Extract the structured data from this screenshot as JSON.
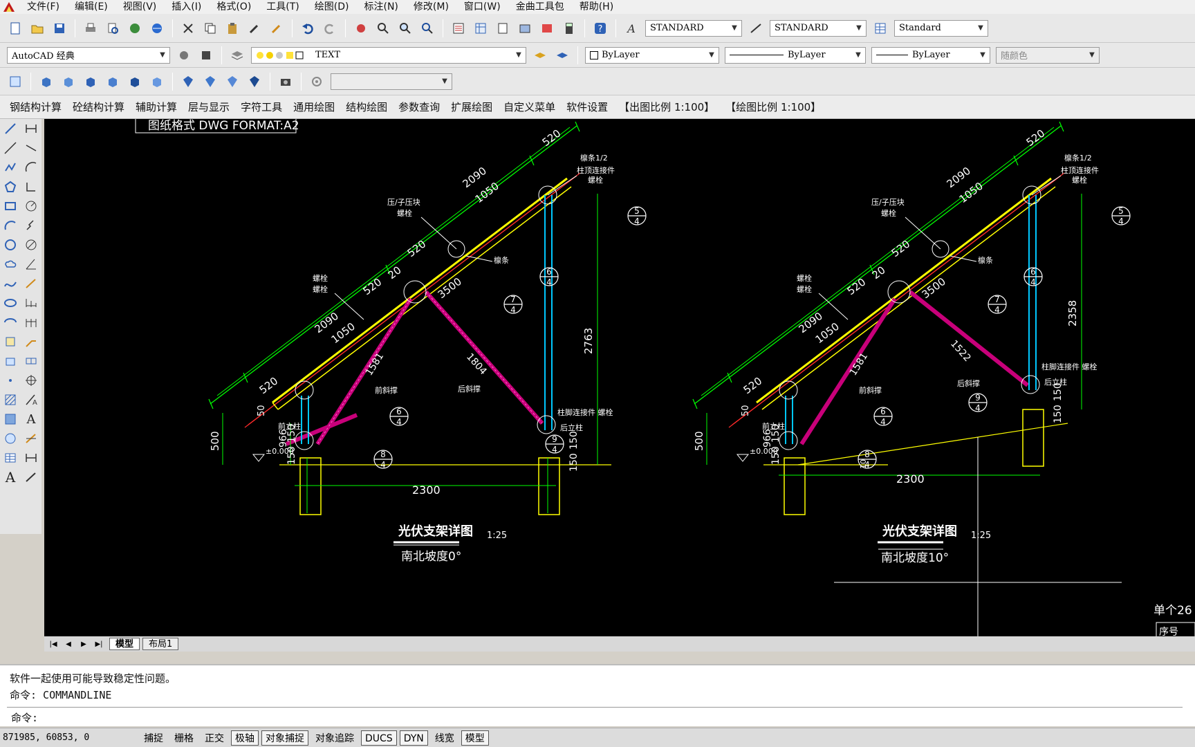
{
  "menubar": {
    "items": [
      "文件(F)",
      "编辑(E)",
      "视图(V)",
      "插入(I)",
      "格式(O)",
      "工具(T)",
      "绘图(D)",
      "标注(N)",
      "修改(M)",
      "窗口(W)",
      "金曲工具包",
      "帮助(H)"
    ]
  },
  "toolbar": {
    "text_style": "STANDARD",
    "dim_style": "STANDARD",
    "table_style": "Standard",
    "workspace": "AutoCAD 经典",
    "layer": "TEXT",
    "color": "ByLayer",
    "linetype": "ByLayer",
    "lineweight": "ByLayer",
    "plotstyle": "随颜色"
  },
  "cnmenu": {
    "items": [
      "钢结构计算",
      "砼结构计算",
      "辅助计算",
      "层与显示",
      "字符工具",
      "通用绘图",
      "结构绘图",
      "参数查询",
      "扩展绘图",
      "自定义菜单",
      "软件设置",
      "【出图比例 1:100】",
      "【绘图比例 1:100】"
    ]
  },
  "drawing": {
    "header_text": "图纸格式 DWG FORMAT:A2",
    "left": {
      "title": "光伏支架详图",
      "scale": "1:25",
      "subtitle": "南北坡度0°",
      "dims": {
        "top_520": "520",
        "top_2090": "2090",
        "top_1050": "1050",
        "mid_520a": "520",
        "mid_20": "20",
        "mid_520b": "520",
        "mid_3500": "3500",
        "low_2090": "2090",
        "low_1050": "1050",
        "low_520": "520",
        "d1581": "1581",
        "d1804": "1804",
        "d2763": "2763",
        "d2300": "2300",
        "d500": "500",
        "d966": "966",
        "d150a": "150",
        "d150b": "150",
        "d150c": "150",
        "d150d": "150",
        "d50": "50",
        "elev": "±0.000"
      },
      "labels": {
        "l1": "檩条1/2",
        "l2": "柱顶连接件",
        "l2b": "螺栓",
        "l3": "压/子压块",
        "l3b": "螺栓",
        "l4": "檩条",
        "l5": "螺栓",
        "l5b": "螺栓",
        "l6": "前斜撑",
        "l7": "后斜撑",
        "l8": "柱脚连接件 螺栓",
        "l9": "后立柱",
        "l10": "前立柱"
      },
      "bubbles": [
        "5",
        "6",
        "7",
        "6",
        "8",
        "9"
      ],
      "bubble_sub": "4"
    },
    "right": {
      "title": "光伏支架详图",
      "scale": "1:25",
      "subtitle": "南北坡度10°",
      "dims": {
        "top_520": "520",
        "top_2090": "2090",
        "top_1050": "1050",
        "mid_520a": "520",
        "mid_20": "20",
        "mid_520b": "520",
        "mid_3500": "3500",
        "low_2090": "2090",
        "low_1050": "1050",
        "low_520": "520",
        "d1581": "1581",
        "d1522": "1522",
        "d2358": "2358",
        "d2300": "2300",
        "d500": "500",
        "d966": "966",
        "d150a": "150",
        "d150b": "150",
        "d150c": "150",
        "d150d": "150",
        "d50": "50",
        "elev": "±0.000",
        "d10": "10"
      },
      "labels": {
        "l1": "檩条1/2",
        "l2": "柱顶连接件",
        "l2b": "螺栓",
        "l3": "压/子压块",
        "l3b": "螺栓",
        "l4": "檩条",
        "l5": "螺栓",
        "l5b": "螺栓",
        "l6": "前斜撑",
        "l7": "后斜撑",
        "l8": "柱脚连接件 螺栓",
        "l9": "后立柱",
        "l10": "前立柱"
      },
      "bubbles": [
        "5",
        "6",
        "7",
        "6",
        "8",
        "9"
      ],
      "bubble_sub": "4"
    },
    "corner_text": "单个26",
    "corner_text2": "序号"
  },
  "tabs": {
    "model": "模型",
    "layout1": "布局1"
  },
  "command": {
    "line1": "软件一起使用可能导致稳定性问题。",
    "line2": "命令: COMMANDLINE",
    "prompt": "命令:"
  },
  "status": {
    "coords": "871985, 60853, 0",
    "buttons": [
      "捕捉",
      "栅格",
      "正交",
      "极轴",
      "对象捕捉",
      "对象追踪",
      "DUCS",
      "DYN",
      "线宽",
      "模型"
    ]
  },
  "colors": {
    "canvas_bg": "#000000",
    "dim_green": "#00ff00",
    "beam_yellow": "#ffff00",
    "brace_magenta": "#c8007a",
    "post_cyan": "#00c8ff",
    "label_white": "#ffffff"
  }
}
